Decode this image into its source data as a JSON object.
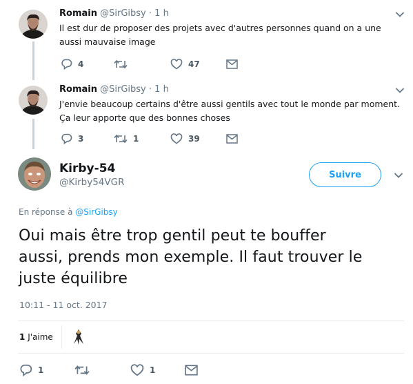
{
  "thread": [
    {
      "name": "Romain",
      "handle": "@SirGibsy",
      "separator": "·",
      "time": "1 h",
      "text_lines": [
        "Il est dur de proposer des projets avec d'autres personnes quand on a une",
        "aussi mauvaise image"
      ],
      "replies": "4",
      "retweets": "",
      "likes": "47"
    },
    {
      "name": "Romain",
      "handle": "@SirGibsy",
      "separator": "·",
      "time": "1 h",
      "text_lines": [
        "J'envie beaucoup certains d'être aussi gentils avec tout le monde par moment.",
        "Ça leur apporte que des bonnes choses"
      ],
      "replies": "3",
      "retweets": "1",
      "likes": "39"
    }
  ],
  "main": {
    "name": "Kirby-54",
    "handle": "@Kirby54VGR",
    "follow_label": "Suivre",
    "reply_prefix": "En réponse à",
    "reply_to": "@SirGibsy",
    "text_lines": [
      "Oui mais être trop gentil peut te bouffer",
      "aussi, prends mon exemple. Il faut trouver le",
      "juste équilibre"
    ],
    "timestamp": "10:11 - 11 oct. 2017",
    "likes_count": "1",
    "likes_label": "J'aime",
    "replies": "1",
    "retweets": "",
    "likes": "1"
  },
  "colors": {
    "accent": "#1da1f2",
    "muted": "#657786",
    "text": "#14171a",
    "thread_line": "#c4d3de"
  },
  "icons": [
    "reply-icon",
    "retweet-icon",
    "like-icon",
    "dm-icon",
    "chevron-down-icon"
  ]
}
